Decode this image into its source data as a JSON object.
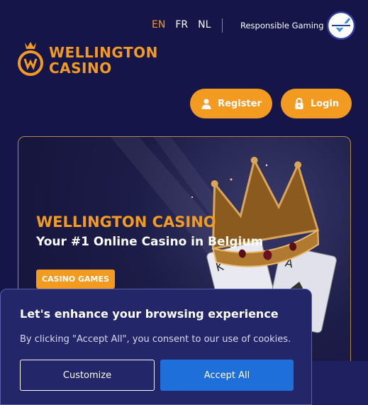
{
  "languages": [
    {
      "code": "EN",
      "active": true
    },
    {
      "code": "FR",
      "active": false
    },
    {
      "code": "NL",
      "active": false
    }
  ],
  "responsible_gaming": "Responsible Gaming",
  "logo": {
    "line1": "WELLINGTON",
    "line2": "CASINO"
  },
  "auth": {
    "register": "Register",
    "login": "Login"
  },
  "hero": {
    "title": "WELLINGTON CASINO",
    "subtitle": "Your #1 Online Casino in Belgium",
    "tag": "CASINO GAMES"
  },
  "cookie": {
    "title": "Let's enhance your browsing experience",
    "text": "By clicking \"Accept All\", you consent to our use of cookies.",
    "customize": "Customize",
    "accept": "Accept All"
  },
  "colors": {
    "accent": "#f39a21",
    "background": "#15154a",
    "accept": "#1e6fd9"
  }
}
